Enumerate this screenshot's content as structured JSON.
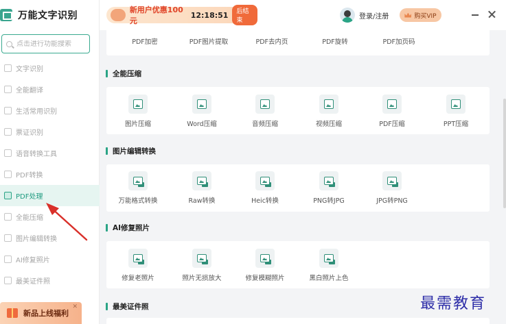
{
  "app": {
    "title": "万能文字识别"
  },
  "search": {
    "placeholder": "点击进行功能搜索"
  },
  "sidebar": {
    "items": [
      {
        "label": "文字识别",
        "icon": "text-scan-icon"
      },
      {
        "label": "全能翻译",
        "icon": "translate-icon"
      },
      {
        "label": "生活常用识别",
        "icon": "life-scan-icon"
      },
      {
        "label": "票证识别",
        "icon": "ticket-icon"
      },
      {
        "label": "语音转换工具",
        "icon": "audio-icon"
      },
      {
        "label": "PDF转换",
        "icon": "pdf-convert-icon"
      },
      {
        "label": "PDF处理",
        "icon": "pdf-process-icon",
        "active": true
      },
      {
        "label": "全能压缩",
        "icon": "compress-icon"
      },
      {
        "label": "图片编辑转换",
        "icon": "image-edit-icon"
      },
      {
        "label": "AI修复照片",
        "icon": "ai-repair-icon"
      },
      {
        "label": "最美证件照",
        "icon": "id-photo-icon"
      }
    ],
    "promo": {
      "label": "新品上线福利",
      "close": "✕"
    }
  },
  "topbar": {
    "offer_text": "新用户优惠100元",
    "timer": "12:18:51",
    "offer_end": "后结束",
    "login": "登录/注册",
    "vip": "购买VIP"
  },
  "sections": {
    "pdf": {
      "tools": [
        "PDF加密",
        "PDF图片提取",
        "PDF去内页",
        "PDF旋转",
        "PDF加页码"
      ]
    },
    "compress": {
      "title": "全能压缩",
      "tools": [
        "图片压缩",
        "Word压缩",
        "音频压缩",
        "视频压缩",
        "PDF压缩",
        "PPT压缩"
      ]
    },
    "image": {
      "title": "图片编辑转换",
      "tools": [
        "万能格式转换",
        "Raw转换",
        "Heic转换",
        "PNG转JPG",
        "JPG转PNG"
      ]
    },
    "ai": {
      "title": "AI修复照片",
      "tools": [
        "修复老照片",
        "照片无损放大",
        "修复模糊照片",
        "黑白照片上色"
      ]
    },
    "cert": {
      "title": "最美证件照"
    }
  },
  "watermark": "最需教育",
  "colors": {
    "accent": "#2aa486",
    "offer": "#e0452a",
    "annotation_arrow": "#d9302a"
  }
}
